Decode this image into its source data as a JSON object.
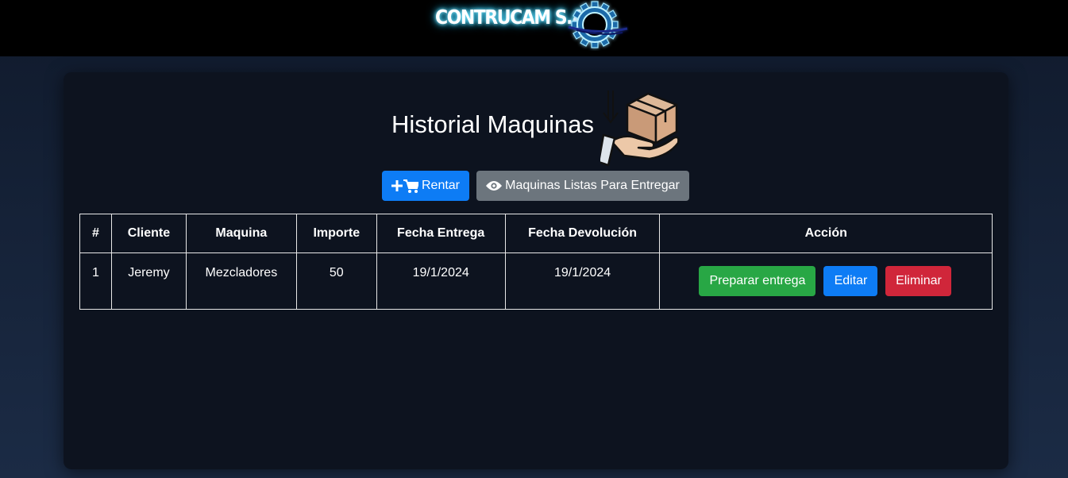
{
  "header": {
    "brand": "CONTRUCAM S.A",
    "logo_icon": "gear-icon"
  },
  "page": {
    "title": "Historial Maquinas",
    "title_icon": "hand-holding-box-icon"
  },
  "toolbar": {
    "rent_label": "Rentar",
    "rent_icon": "plus-cart-icon",
    "ready_label": "Maquinas Listas Para Entregar",
    "ready_icon": "eye-icon"
  },
  "table": {
    "headers": [
      "#",
      "Cliente",
      "Maquina",
      "Importe",
      "Fecha Entrega",
      "Fecha Devolución",
      "Acción"
    ],
    "rows": [
      {
        "num": "1",
        "cliente": "Jeremy",
        "maquina": "Mezcladores",
        "importe": "50",
        "fecha_entrega": "19/1/2024",
        "fecha_devolucion": "19/1/2024",
        "actions": {
          "prepare": "Preparar entrega",
          "edit": "Editar",
          "delete": "Eliminar"
        }
      }
    ]
  },
  "colors": {
    "primary": "#0d7cf5",
    "secondary": "#6c757d",
    "success": "#28a745",
    "danger": "#d0263a",
    "card_bg": "#0d131f"
  }
}
